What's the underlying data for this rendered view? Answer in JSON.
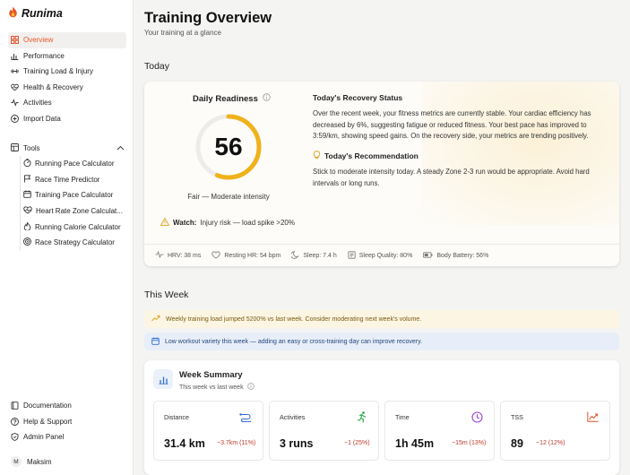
{
  "brand": {
    "name": "Runima",
    "accent": "#e8552a"
  },
  "sidebar": {
    "items": [
      {
        "label": "Overview",
        "icon": "grid-icon",
        "active": true
      },
      {
        "label": "Performance",
        "icon": "bar-chart-icon"
      },
      {
        "label": "Training Load & Injury",
        "icon": "dumbbell-icon"
      },
      {
        "label": "Health & Recovery",
        "icon": "heart-pulse-icon"
      },
      {
        "label": "Activities",
        "icon": "activity-icon"
      },
      {
        "label": "Import Data",
        "icon": "plus-circle-icon"
      }
    ],
    "tools_label": "Tools",
    "tools": [
      "Running Pace Calculator",
      "Race Time Predictor",
      "Training Pace Calculator",
      "Heart Rate Zone Calculat...",
      "Running Calorie Calculator",
      "Race Strategy Calculator"
    ],
    "bottom": [
      {
        "label": "Documentation",
        "icon": "book-icon"
      },
      {
        "label": "Help & Support",
        "icon": "help-circle-icon"
      },
      {
        "label": "Admin Panel",
        "icon": "shield-icon"
      }
    ],
    "user": {
      "initial": "M",
      "name": "Maksim"
    }
  },
  "header": {
    "title": "Training Overview",
    "subtitle": "Your training at a glance"
  },
  "today": {
    "section_title": "Today",
    "readiness_title": "Daily Readiness",
    "readiness_value": "56",
    "readiness_fraction": 0.56,
    "readiness_color": "#f0b21b",
    "readiness_label": "Fair — Moderate intensity",
    "watch_label": "Watch:",
    "watch_text": "Injury risk — load spike >20%",
    "recovery_title": "Today's Recovery Status",
    "recovery_text": "Over the recent week, your fitness metrics are currently stable. Your cardiac efficiency has decreased by 6%, suggesting fatigue or reduced fitness. Your best pace has improved to 3:59/km, showing speed gains. On the recovery side, your metrics are trending positively.",
    "recommendation_title": "Today's Recommendation",
    "recommendation_text": "Stick to moderate intensity today. A steady Zone 2-3 run would be appropriate. Avoid hard intervals or long runs.",
    "metrics": [
      {
        "label": "HRV: 38 ms",
        "icon": "pulse-icon"
      },
      {
        "label": "Resting HR: 54 bpm",
        "icon": "heart-icon"
      },
      {
        "label": "Sleep: 7.4 h",
        "icon": "moon-icon"
      },
      {
        "label": "Sleep Quality: 80%",
        "icon": "sleep-quality-icon"
      },
      {
        "label": "Body Battery: 56%",
        "icon": "battery-icon"
      }
    ]
  },
  "week": {
    "section_title": "This Week",
    "alert_warning": "Weekly training load jumped 5200% vs last week. Consider moderating next week's volume.",
    "alert_info": "Low workout variety this week — adding an easy or cross-training day can improve recovery.",
    "summary_title": "Week Summary",
    "summary_subtitle": "This week vs last week",
    "stats": [
      {
        "label": "Distance",
        "value": "31.4 km",
        "delta": "−3.7km (11%)",
        "icon": "route-icon",
        "color": "#2f6fd1"
      },
      {
        "label": "Activities",
        "value": "3 runs",
        "delta": "−1 (25%)",
        "icon": "runner-icon",
        "color": "#28a745"
      },
      {
        "label": "Time",
        "value": "1h 45m",
        "delta": "−15m (13%)",
        "icon": "clock-icon",
        "color": "#a23fd0"
      },
      {
        "label": "TSS",
        "value": "89",
        "delta": "−12 (12%)",
        "icon": "trend-icon",
        "color": "#e8552a"
      }
    ]
  }
}
